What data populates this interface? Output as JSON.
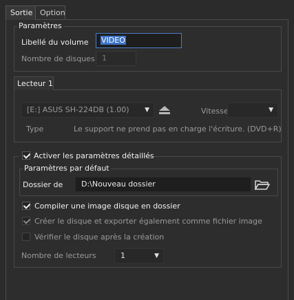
{
  "tabs": [
    {
      "label": "Sortie",
      "active": true
    },
    {
      "label": "Option",
      "active": false
    }
  ],
  "parametres": {
    "title": "Paramètres",
    "volume_label_label": "Libellé du volume",
    "volume_label_value": "VIDEO",
    "disc_count_label": "Nombre de disques",
    "disc_count_value": "1"
  },
  "drive": {
    "tab_label": "Lecteur 1",
    "device": "[E:] ASUS SH-224DB (1.00)",
    "eject_icon": "eject-icon",
    "speed_label": "Vitesse",
    "speed_value": "",
    "type_label": "Type",
    "type_value": "Le support ne prend pas en charge l'écriture. (DVD+R)"
  },
  "advanced": {
    "checkbox_label": "Activer les paramètres détaillés",
    "checked": true,
    "defaults_title": "Paramètres par défaut",
    "folder_label": "Dossier de",
    "folder_value": "D:\\Nouveau dossier",
    "folder_icon": "folder-open-icon",
    "compile_label": "Compiler une image disque en dossier",
    "compile_checked": true,
    "export_label": "Créer le disque et exporter également comme fichier image",
    "export_checked": true,
    "verify_label": "Vérifier le disque après la création",
    "verify_checked": false,
    "drives_label": "Nombre de lecteurs",
    "drives_value": "1"
  }
}
